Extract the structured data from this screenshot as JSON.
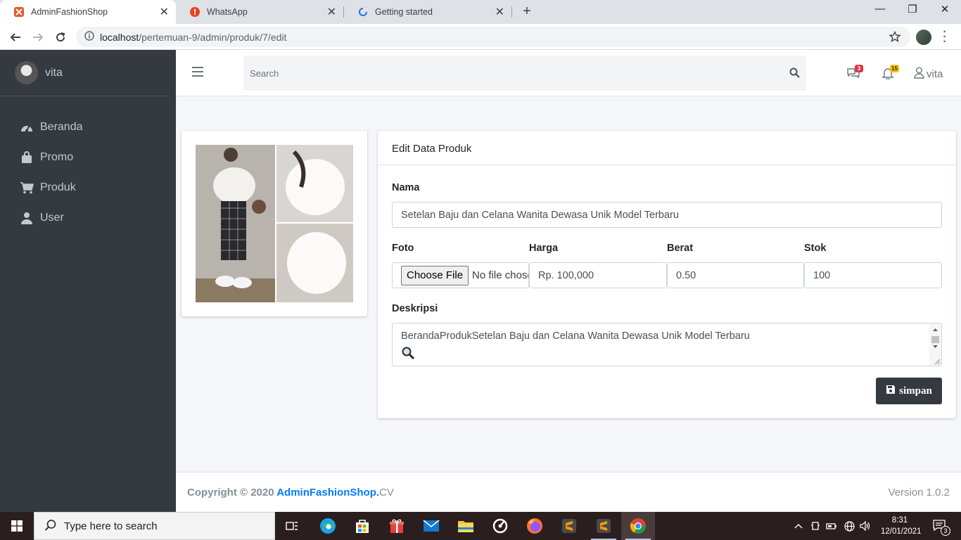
{
  "browser": {
    "tabs": [
      {
        "label": "AdminFashionShop",
        "active": true
      },
      {
        "label": "WhatsApp",
        "active": false
      },
      {
        "label": "Getting started",
        "active": false
      }
    ],
    "url_host": "localhost",
    "url_path": "/pertemuan-9/admin/produk/7/edit"
  },
  "sidebar": {
    "user_name": "vita",
    "items": [
      {
        "label": "Beranda",
        "icon": "tachometer-icon"
      },
      {
        "label": "Promo",
        "icon": "shopping-bag-icon"
      },
      {
        "label": "Produk",
        "icon": "shopping-cart-icon"
      },
      {
        "label": "User",
        "icon": "user-icon"
      }
    ]
  },
  "topnav": {
    "search_placeholder": "Search",
    "messages_badge": "3",
    "notifications_badge": "15",
    "user_name": "vita",
    "colors": {
      "messages_badge": "#dc3545",
      "notifications_badge": "#ffc107"
    }
  },
  "form": {
    "title": "Edit Data Produk",
    "nama_label": "Nama",
    "nama_value": "Setelan Baju dan Celana Wanita Dewasa Unik Model Terbaru",
    "foto_label": "Foto",
    "file_button": "Choose File",
    "file_status": "No file chosen",
    "harga_label": "Harga",
    "harga_value": "Rp. 100,000",
    "berat_label": "Berat",
    "berat_value": "0.50",
    "stok_label": "Stok",
    "stok_value": "100",
    "deskripsi_label": "Deskripsi",
    "deskripsi_value": "BerandaProdukSetelan Baju dan Celana Wanita Dewasa Unik Model Terbaru",
    "save_label": "simpan"
  },
  "footer": {
    "copyright_prefix": "Copyright © 2020",
    "brand": "AdminFashionShop.",
    "brand_suffix": "CV",
    "version": "Version 1.0.2"
  },
  "taskbar": {
    "search_text": "Type here to search",
    "time": "8:31",
    "date": "12/01/2021",
    "notification_count": "3"
  }
}
